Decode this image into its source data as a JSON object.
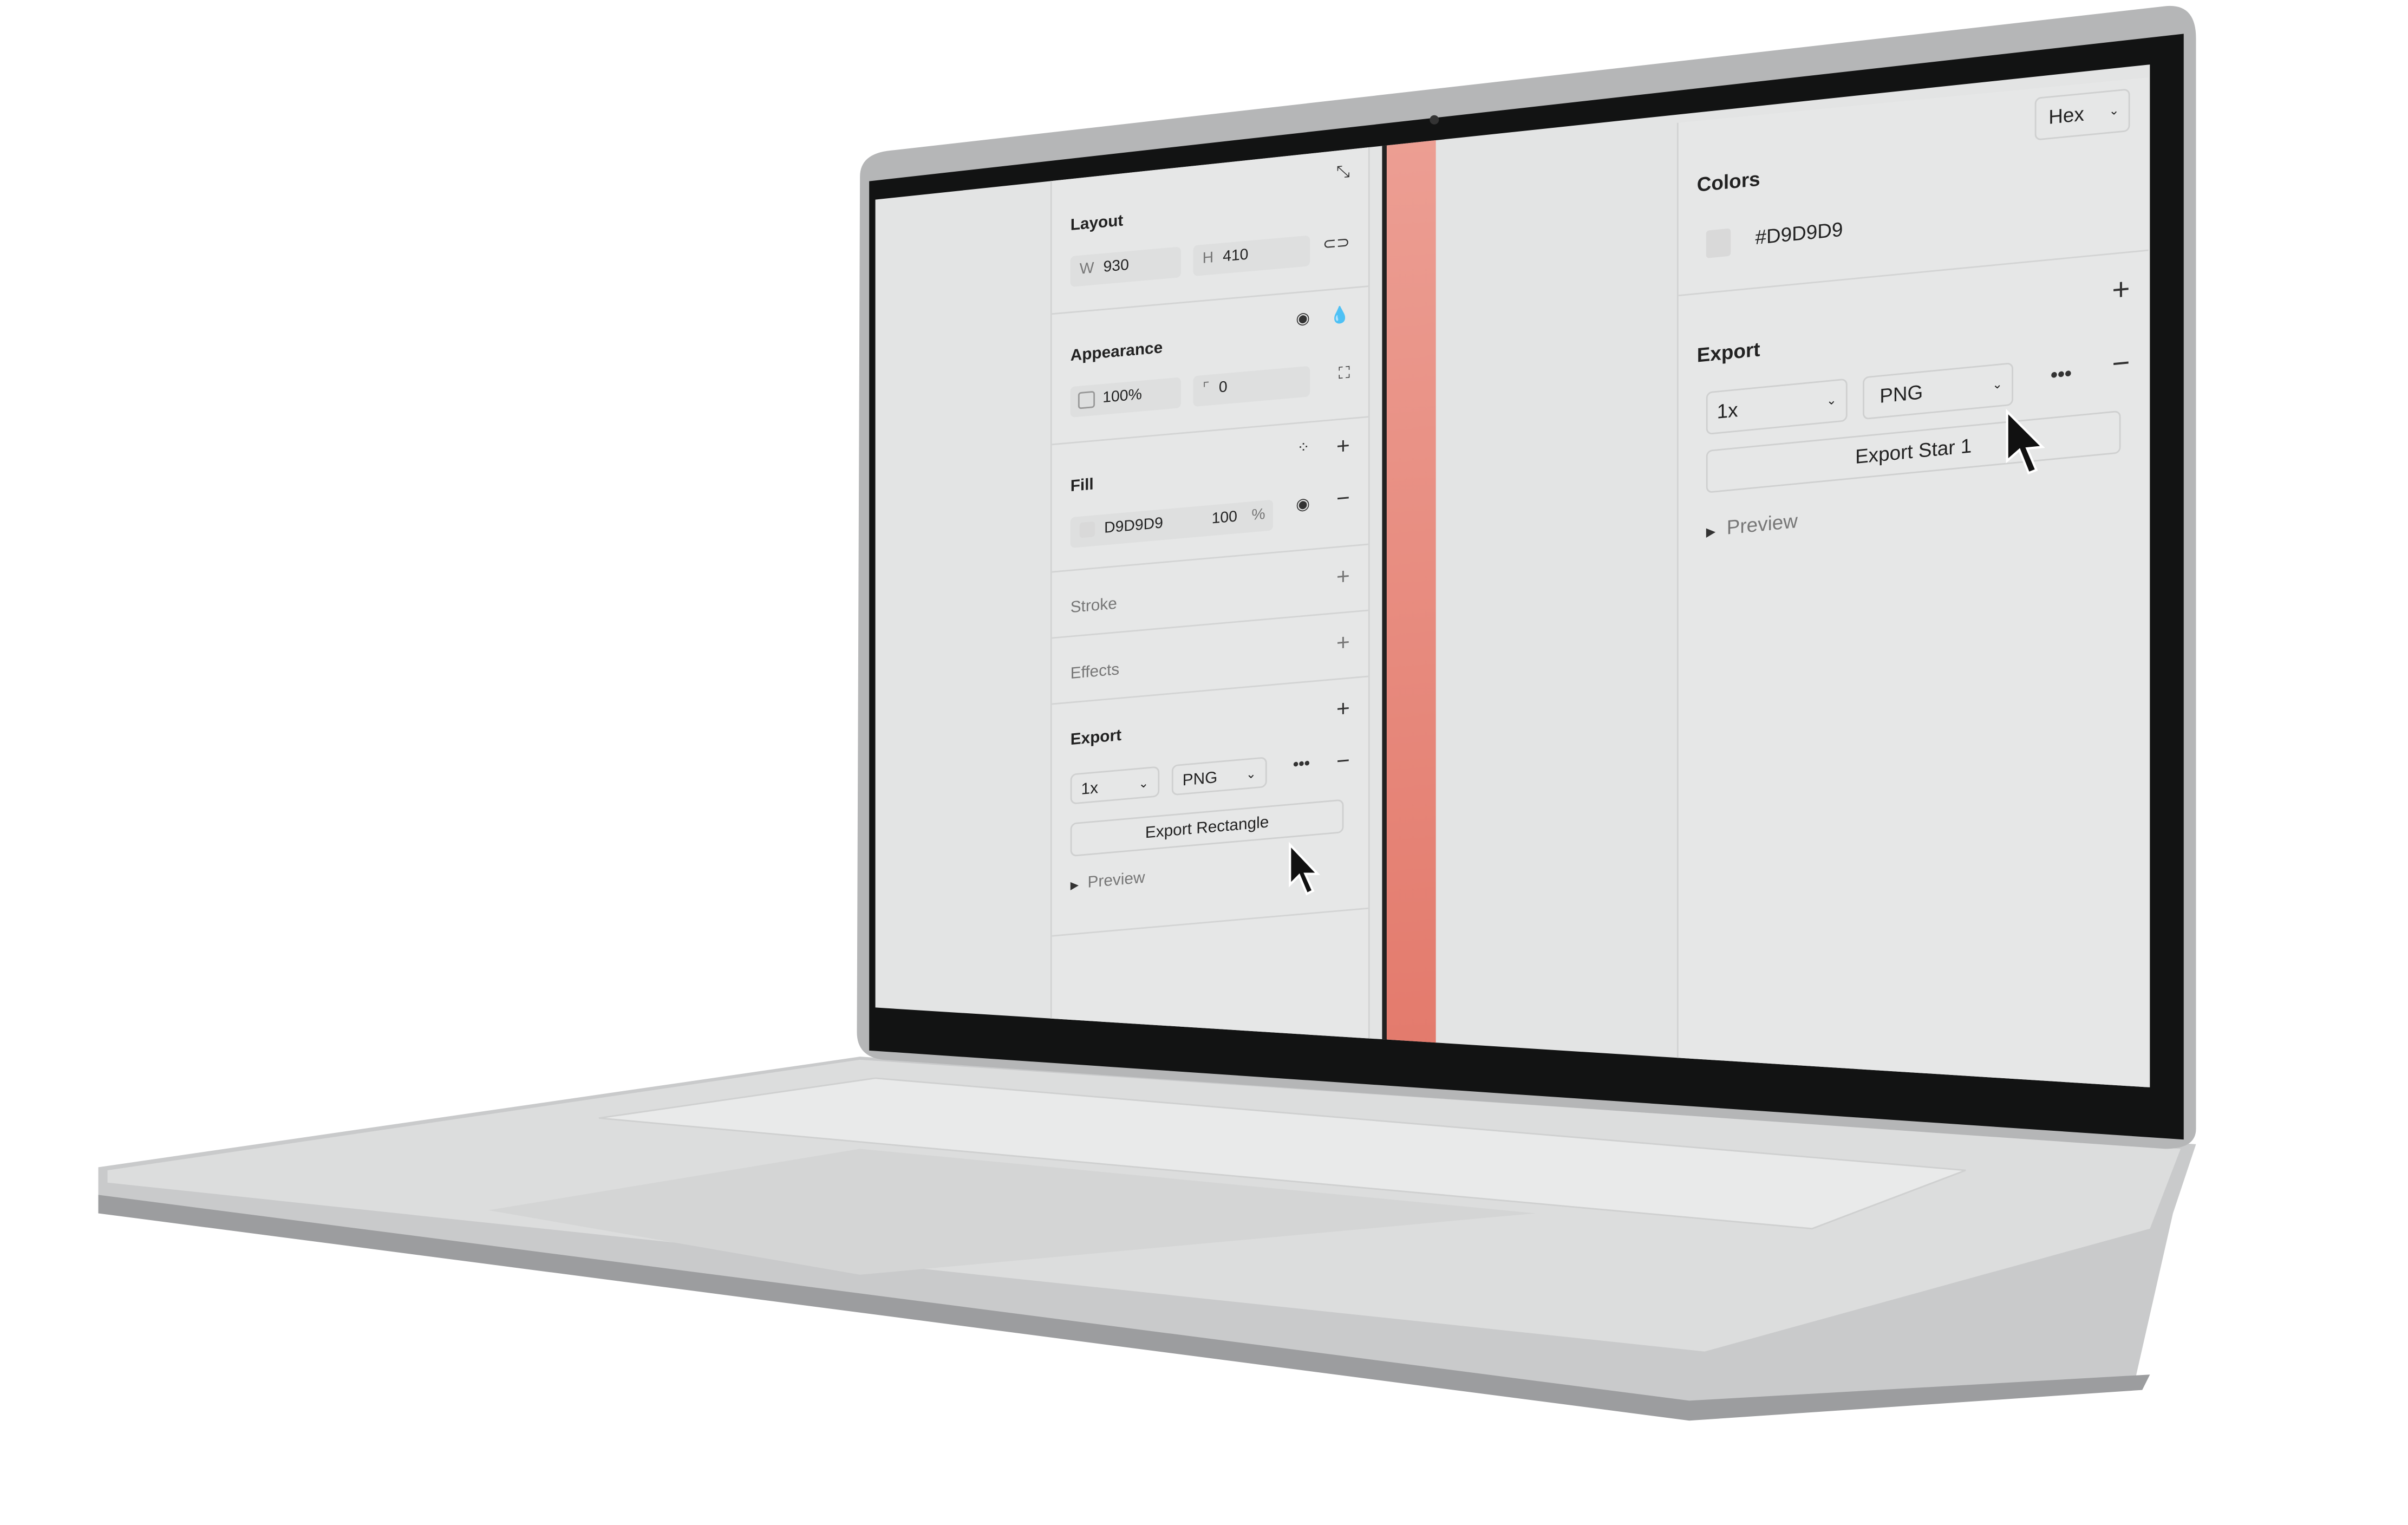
{
  "left_panel": {
    "layout": {
      "title": "Layout",
      "w_label": "W",
      "w_value": "930",
      "h_label": "H",
      "h_value": "410"
    },
    "appearance": {
      "title": "Appearance",
      "opacity": "100%",
      "radius": "0"
    },
    "fill": {
      "title": "Fill",
      "hex": "D9D9D9",
      "opacity": "100",
      "percent": "%"
    },
    "stroke": {
      "title": "Stroke"
    },
    "effects": {
      "title": "Effects"
    },
    "export": {
      "title": "Export",
      "scale": "1x",
      "format": "PNG",
      "button": "Export Rectangle",
      "preview": "Preview"
    }
  },
  "right_panel": {
    "color_format": "Hex",
    "colors": {
      "title": "Colors",
      "hex": "#D9D9D9"
    },
    "export": {
      "title": "Export",
      "scale": "1x",
      "format": "PNG",
      "button": "Export Star 1",
      "preview": "Preview"
    }
  },
  "colors": {
    "swatch": "#D9D9D9",
    "stripe": "#E58374"
  }
}
